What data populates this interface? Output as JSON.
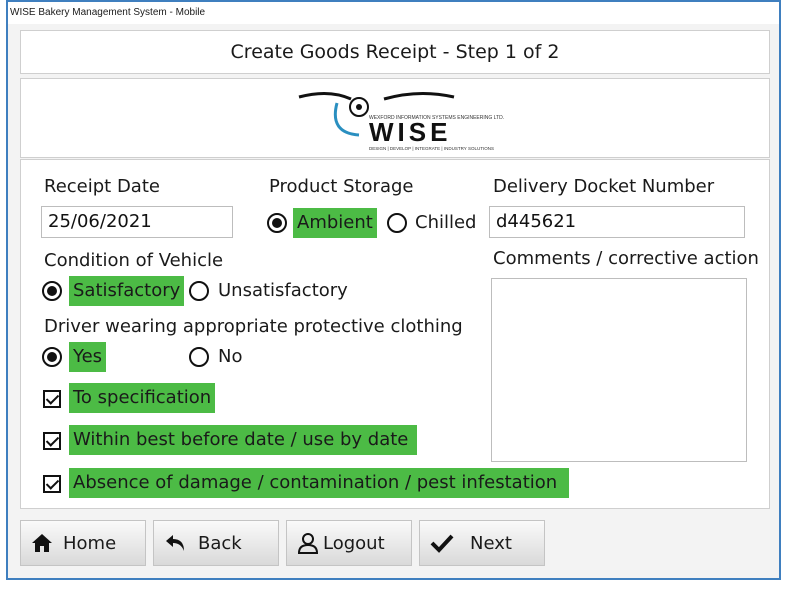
{
  "window": {
    "title": "WISE Bakery Management System - Mobile"
  },
  "header": {
    "title": "Create Goods Receipt - Step 1 of 2"
  },
  "logo": {
    "brand": "WISE",
    "line1": "WEXFORD INFORMATION SYSTEMS ENGINEERING LTD.",
    "tagline": "DESIGN | DEVELOP | INTEGRATE | INDUSTRY SOLUTIONS"
  },
  "form": {
    "receipt_date_label": "Receipt Date",
    "receipt_date_value": "25/06/2021",
    "product_storage_label": "Product Storage",
    "storage_options": {
      "ambient": "Ambient",
      "chilled": "Chilled"
    },
    "storage_selected": "Ambient",
    "docket_label": "Delivery Docket Number",
    "docket_value": "d445621",
    "vehicle_label": "Condition of Vehicle",
    "vehicle_options": {
      "satisfactory": "Satisfactory",
      "unsatisfactory": "Unsatisfactory"
    },
    "vehicle_selected": "Satisfactory",
    "clothing_label": "Driver wearing appropriate protective clothing",
    "clothing_options": {
      "yes": "Yes",
      "no": "No"
    },
    "clothing_selected": "Yes",
    "comments_label": "Comments / corrective action",
    "comments_value": "",
    "checks": {
      "spec": "To specification",
      "best_before": "Within best before date / use by date",
      "damage": "Absence of damage / contamination / pest infestation"
    }
  },
  "nav": {
    "home": "Home",
    "back": "Back",
    "logout": "Logout",
    "next": "Next"
  },
  "colors": {
    "highlight": "#4cbb45",
    "window_border": "#3f7fbf"
  }
}
